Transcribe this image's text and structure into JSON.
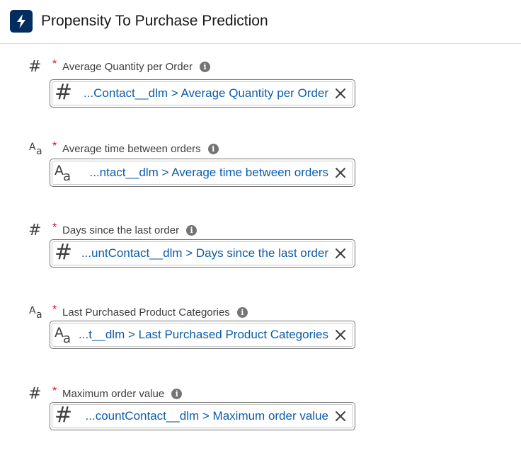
{
  "header": {
    "title": "Propensity To Purchase Prediction",
    "icon": "lightning-bolt-icon",
    "icon_bg": "#032d60"
  },
  "required_marker": "*",
  "info_glyph": "i",
  "fields": [
    {
      "type_icon": "number-type-icon",
      "label": "Average Quantity per Order",
      "value": "...Contact__dlm > Average Quantity per Order"
    },
    {
      "type_icon": "text-type-icon",
      "label": "Average time between orders",
      "value": "...ntact__dlm > Average time between orders"
    },
    {
      "type_icon": "number-type-icon",
      "label": "Days since the last order",
      "value": "...untContact__dlm > Days since the last order"
    },
    {
      "type_icon": "text-type-icon",
      "label": "Last Purchased Product Categories",
      "value": "...t__dlm > Last Purchased Product Categories"
    },
    {
      "type_icon": "number-type-icon",
      "label": "Maximum order value",
      "value": "...countContact__dlm > Maximum order value"
    }
  ],
  "colors": {
    "link": "#0b5cab",
    "required": "#ea001e"
  }
}
